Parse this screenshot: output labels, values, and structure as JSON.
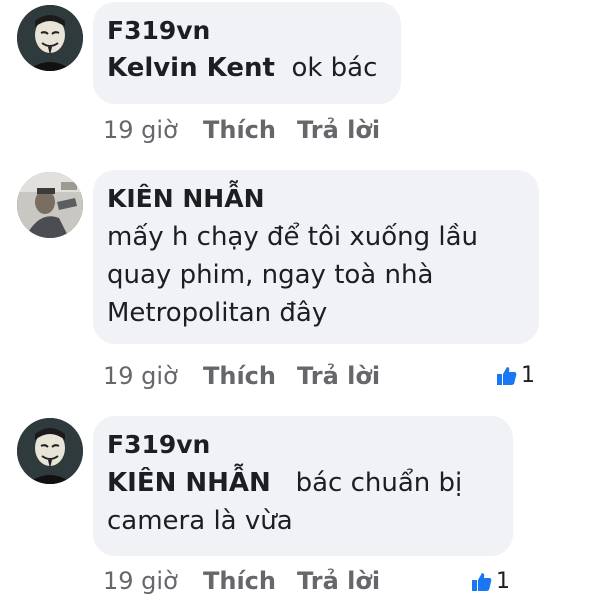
{
  "comments": [
    {
      "author": "F319vn",
      "mention": "Kelvin Kent",
      "text": "ok bác",
      "time": "19 giờ",
      "like_label": "Thích",
      "reply_label": "Trả lời",
      "reactions": ""
    },
    {
      "author": "KIÊN NHẪN",
      "lines": [
        "mấy h chạy để tôi xuống lầu",
        "quay phim, ngay toà nhà",
        "Metropolitan đây"
      ],
      "time": "19 giờ",
      "like_label": "Thích",
      "reply_label": "Trả lời",
      "reactions": "1"
    },
    {
      "author": "F319vn",
      "mention": "KIÊN NHẪN",
      "text": "bác chuẩn bị",
      "text2": "camera là vừa",
      "time": "19 giờ",
      "like_label": "Thích",
      "reply_label": "Trả lời",
      "reactions": "1"
    }
  ],
  "colors": {
    "bubble": "#f0f2f5",
    "meta": "#65676b",
    "like_blue": "#1877f2"
  },
  "icons": {
    "avatar_1": "anonymous-mask-avatar",
    "avatar_2": "street-photo-avatar",
    "avatar_3": "anonymous-mask-avatar",
    "reaction": "thumbs-up-icon"
  }
}
